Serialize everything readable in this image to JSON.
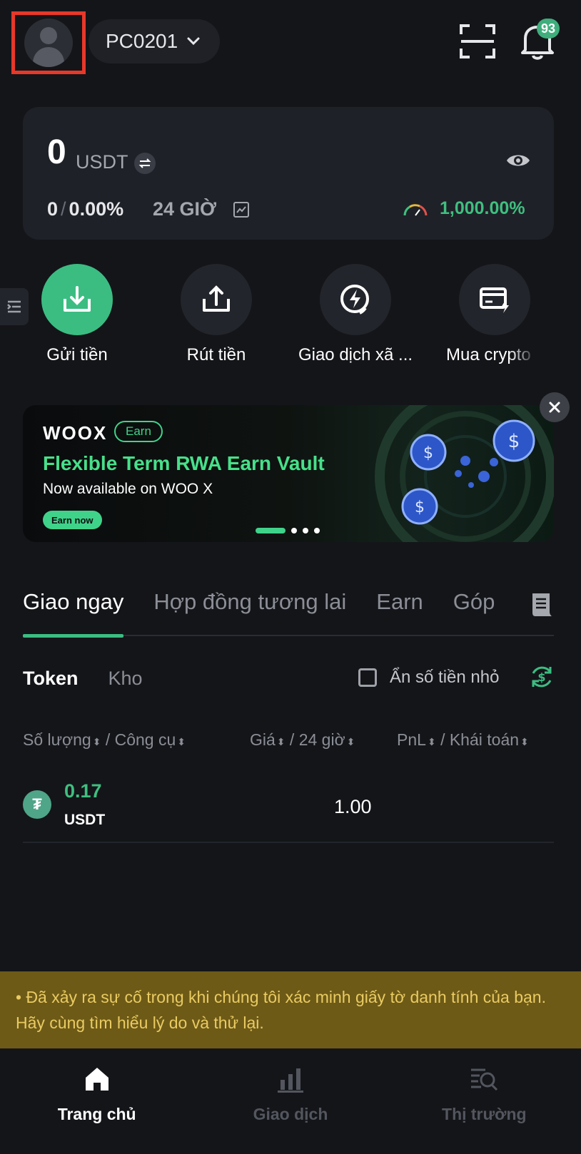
{
  "header": {
    "account_name": "PC0201",
    "notification_count": "93"
  },
  "balance": {
    "amount": "0",
    "unit": "USDT",
    "pnl_value": "0",
    "pnl_separator": "/",
    "pnl_percent": "0.00%",
    "period": "24 GIỜ",
    "margin_ratio": "1,000.00%"
  },
  "actions": [
    {
      "label": "Gửi tiền",
      "icon": "deposit-icon"
    },
    {
      "label": "Rút tiền",
      "icon": "withdraw-icon"
    },
    {
      "label": "Giao dịch xã ...",
      "icon": "copy-trade-icon"
    },
    {
      "label": "Mua crypto",
      "icon": "buy-crypto-icon"
    }
  ],
  "banner": {
    "brand": "WOOX",
    "tag": "Earn",
    "title": "Flexible Term RWA Earn Vault",
    "subtitle": "Now available on WOO X",
    "cta": "Earn now"
  },
  "tabs": [
    "Giao ngay",
    "Hợp đồng tương lai",
    "Earn",
    "Góp"
  ],
  "subtabs": [
    "Token",
    "Kho"
  ],
  "hide_small_label": "Ẩn số tiền nhỏ",
  "columns": {
    "qty": "Số lượng",
    "tool": "Công cụ",
    "price": "Giá",
    "change": "24 giờ",
    "pnl": "PnL",
    "overview": "Khái toán",
    "slash": "/"
  },
  "assets": [
    {
      "quantity": "0.17",
      "symbol": "USDT",
      "price": "1.00"
    }
  ],
  "alert": "• Đã xảy ra sự cố trong khi chúng tôi xác minh giấy tờ danh tính của bạn. Hãy cùng tìm hiểu lý do và thử lại.",
  "nav": [
    "Trang chủ",
    "Giao dịch",
    "Thị trường"
  ],
  "colors": {
    "accent": "#3bbd82",
    "alert_bg": "#6e5a17",
    "alert_text": "#e9cb62",
    "highlight_box": "#e8382a"
  }
}
